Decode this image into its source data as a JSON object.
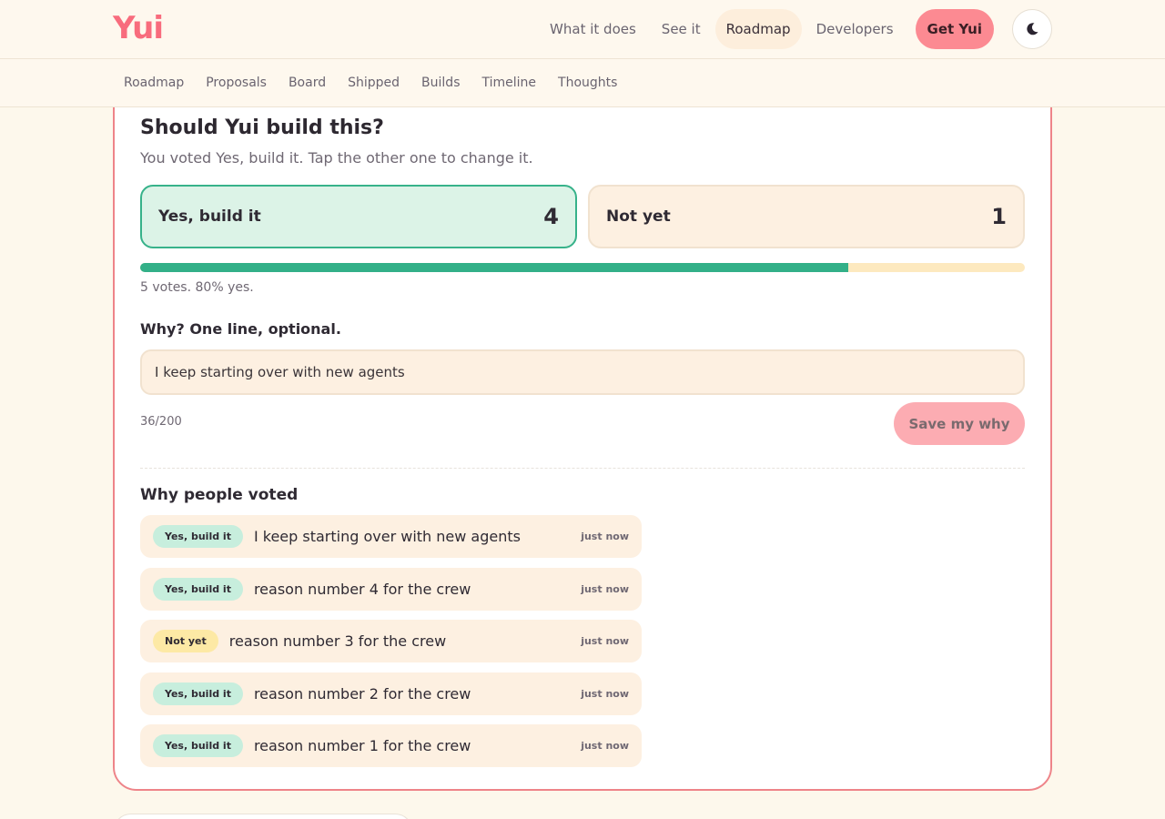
{
  "brand": {
    "logo_text": "Yui",
    "accent": "#f86c7d"
  },
  "nav": {
    "links": [
      {
        "label": "What it does"
      },
      {
        "label": "See it"
      },
      {
        "label": "Roadmap",
        "active": true
      },
      {
        "label": "Developers"
      }
    ],
    "cta": "Get Yui",
    "theme_icon": "moon-icon"
  },
  "subnav": [
    "Roadmap",
    "Proposals",
    "Board",
    "Shipped",
    "Builds",
    "Timeline",
    "Thoughts"
  ],
  "poll": {
    "title": "Should Yui build this?",
    "subtitle": "You voted Yes, build it. Tap the other one to change it.",
    "options": [
      {
        "label": "Yes, build it",
        "count": "4",
        "selected": true
      },
      {
        "label": "Not yet",
        "count": "1",
        "selected": false
      }
    ],
    "yes_fraction": 0.8,
    "summary": "5 votes. 80% yes.",
    "why_label": "Why? One line, optional.",
    "why_value": "I keep starting over with new agents",
    "char_count": "36/200",
    "save_label": "Save my why"
  },
  "reasons": {
    "title": "Why people voted",
    "items": [
      {
        "vote": "Yes, build it",
        "kind": "yes",
        "text": "I keep starting over with new agents",
        "time": "just now"
      },
      {
        "vote": "Yes, build it",
        "kind": "yes",
        "text": "reason number 4 for the crew",
        "time": "just now"
      },
      {
        "vote": "Not yet",
        "kind": "no",
        "text": "reason number 3 for the crew",
        "time": "just now"
      },
      {
        "vote": "Yes, build it",
        "kind": "yes",
        "text": "reason number 2 for the crew",
        "time": "just now"
      },
      {
        "vote": "Yes, build it",
        "kind": "yes",
        "text": "reason number 1 for the crew",
        "time": "just now"
      }
    ]
  }
}
